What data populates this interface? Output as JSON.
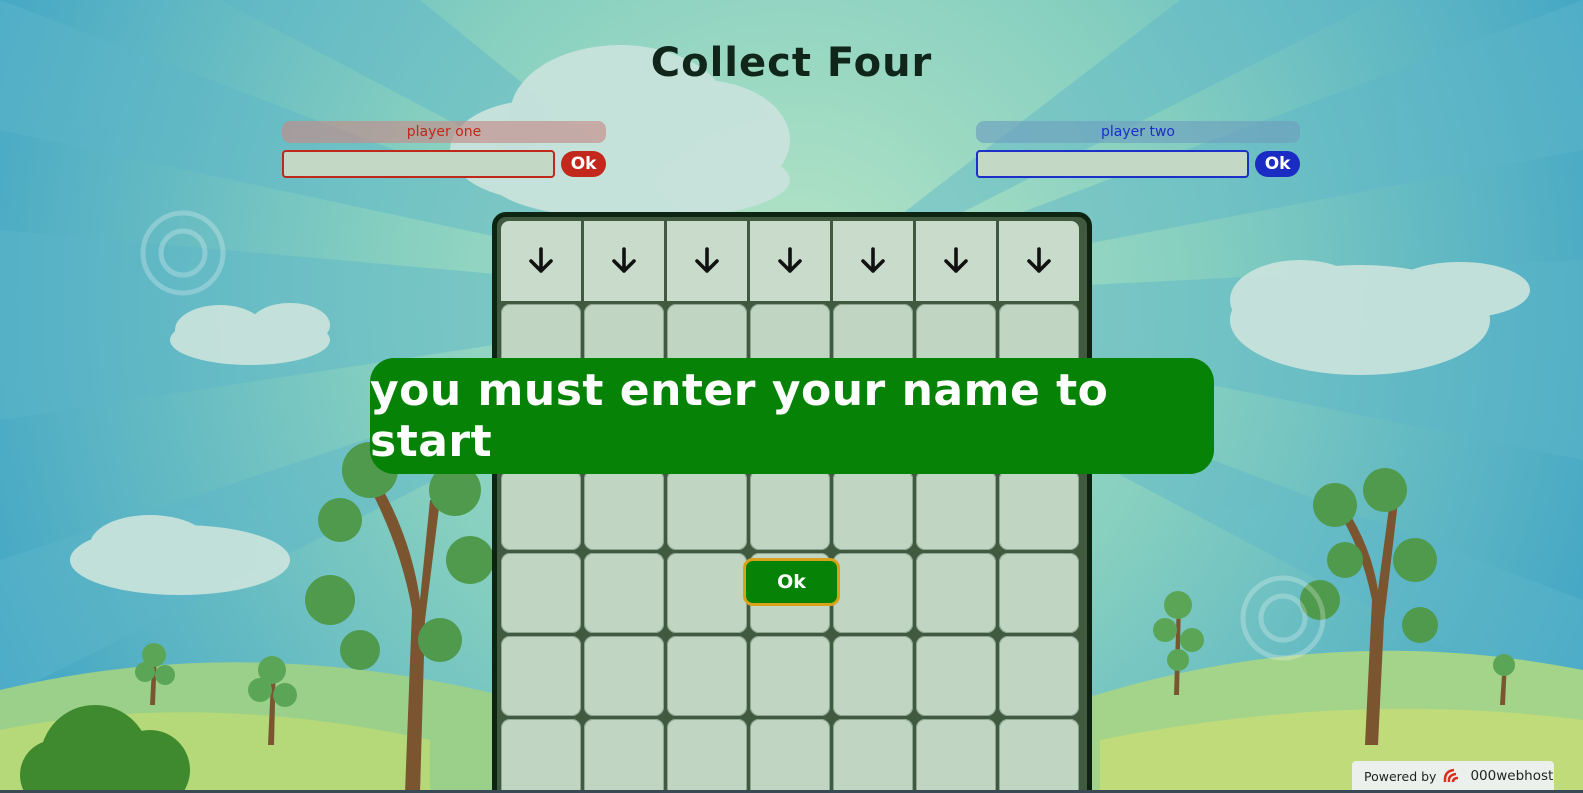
{
  "page": {
    "title": "Collect Four"
  },
  "players": {
    "one": {
      "label": "player one",
      "input_value": "",
      "ok_label": "Ok",
      "color": "#c3281c"
    },
    "two": {
      "label": "player two",
      "input_value": "",
      "ok_label": "Ok",
      "color": "#1b2cc4"
    }
  },
  "board": {
    "columns": 7,
    "visible_rows": 6,
    "drop_icon": "arrow-down-icon"
  },
  "modal": {
    "message": "you must enter your name to start",
    "ok_label": "Ok",
    "color": "#068306"
  },
  "footer": {
    "powered_by": "Powered by",
    "brand": "000webhost"
  }
}
